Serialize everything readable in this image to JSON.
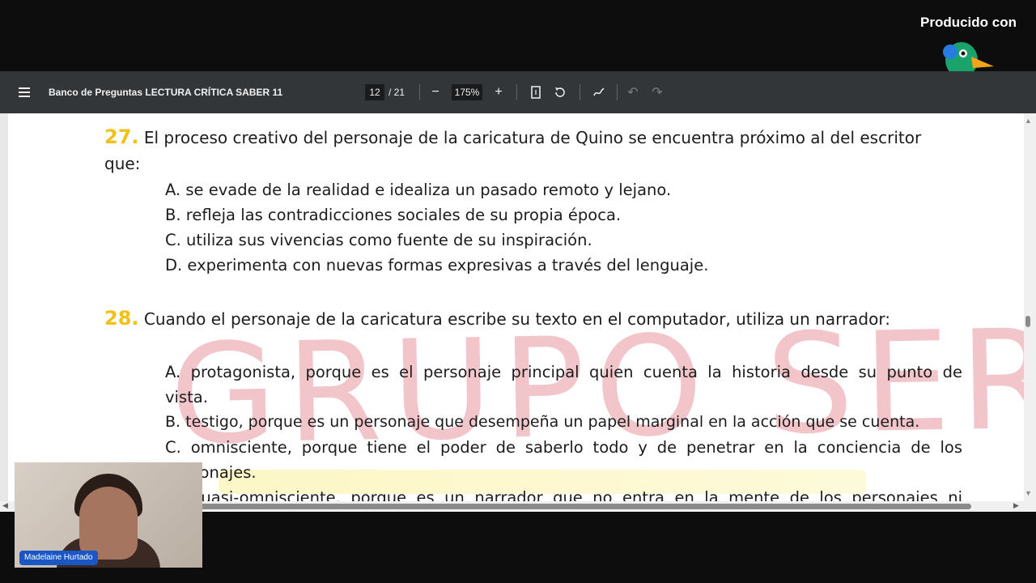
{
  "branding": {
    "produced_with": "Producido con",
    "logo_name": "StreamYard"
  },
  "toolbar": {
    "title": "Banco de Preguntas LECTURA CRÍTICA SABER 11",
    "page_current": "12",
    "page_total": "/ 21",
    "zoom": "175%"
  },
  "watermark": "GRUPO SER",
  "q27": {
    "number": "27.",
    "text": "El proceso creativo del personaje de la caricatura de Quino se encuentra próximo al del escritor",
    "text2": "que:",
    "options": [
      "A. se evade de la realidad e idealiza un pasado remoto y lejano.",
      "B. refleja las contradicciones sociales de su propia época.",
      "C. utiliza sus vivencias como fuente de su inspiración.",
      "D. experimenta con nuevas formas expresivas a través del lenguaje."
    ]
  },
  "q28": {
    "number": "28.",
    "text": "Cuando el personaje de la caricatura escribe su texto en el computador, utiliza un narrador:",
    "options": [
      "A. protagonista, porque es el personaje principal quien cuenta la historia desde su punto de",
      "vista.",
      "B. testigo, porque es un personaje que desempeña un papel marginal en la acción que se cuenta.",
      "C. omnisciente, porque tiene el poder de saberlo todo y de penetrar en la conciencia de los",
      "personajes.",
      "D. cuasi-omnisciente, porque es un narrador que no entra en la mente de los personajes ni"
    ]
  },
  "webcam": {
    "name": "Madelaine Hurtado"
  }
}
